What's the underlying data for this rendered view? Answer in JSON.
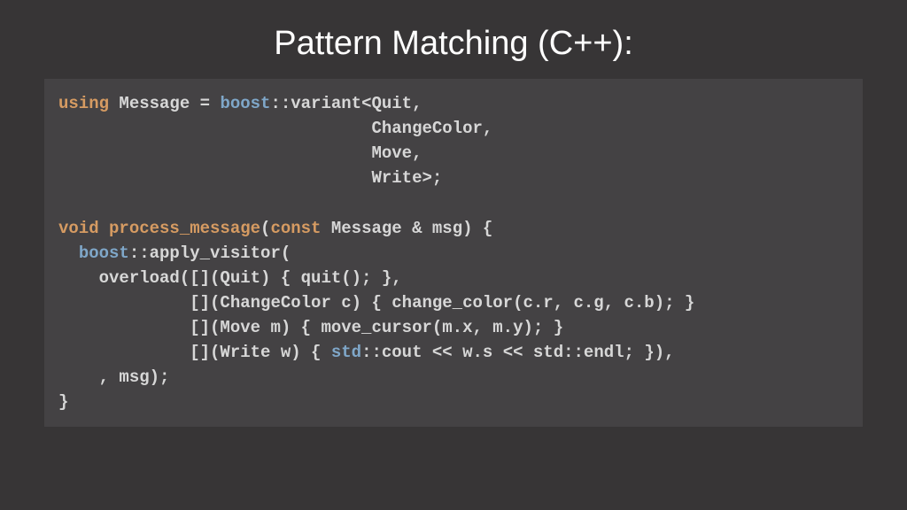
{
  "title": "Pattern Matching (C++):",
  "code": {
    "l1a": "using",
    "l1b": " Message = ",
    "l1c": "boost",
    "l1d": "::variant<Quit,",
    "l2": "                               ChangeColor,",
    "l3": "                               Move,",
    "l4": "                               Write>;",
    "blank1": "",
    "l5a": "void",
    "l5b": " ",
    "l5c": "process_message",
    "l5d": "(",
    "l5e": "const",
    "l5f": " Message & msg) {",
    "l6a": "  ",
    "l6b": "boost",
    "l6c": "::apply_visitor(",
    "l7": "    overload([](Quit) { quit(); },",
    "l8": "             [](ChangeColor c) { change_color(c.r, c.g, c.b); }",
    "l9": "             [](Move m) { move_cursor(m.x, m.y); }",
    "l10a": "             [](Write w) { ",
    "l10b": "std",
    "l10c": "::cout << w.s << std::endl; }),",
    "l11": "    , msg);",
    "l12": "}"
  }
}
